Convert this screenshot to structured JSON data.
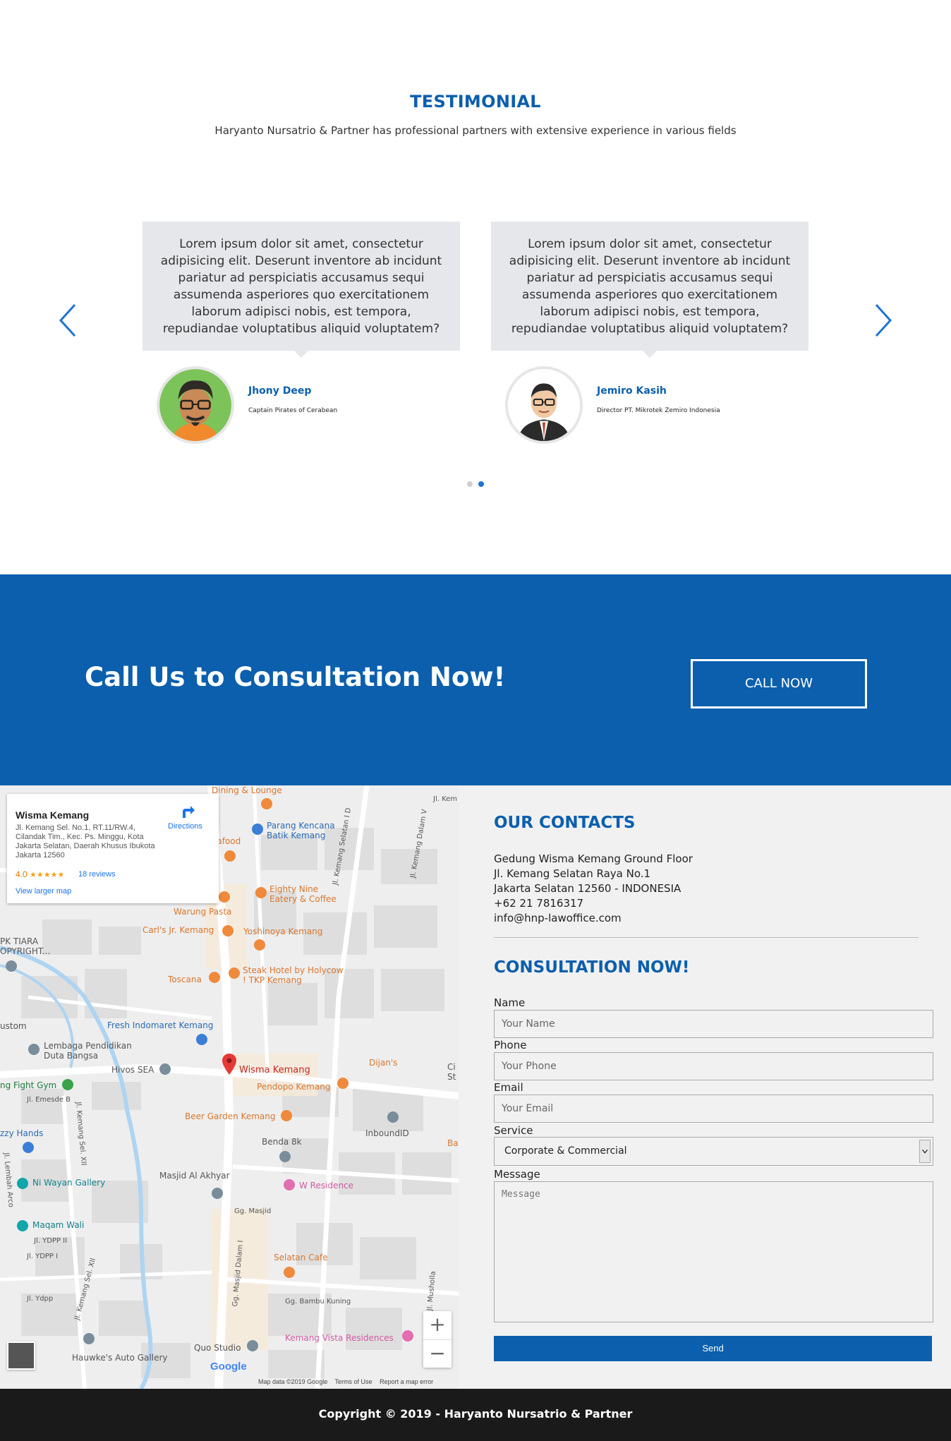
{
  "testimonial": {
    "title": "TESTIMONIAL",
    "subtitle": "Haryanto Nursatrio & Partner has professional partners with extensive experience in various fields",
    "cards": [
      {
        "quote": "Lorem ipsum dolor sit amet, consectetur adipisicing elit. Deserunt inventore ab incidunt pariatur ad perspiciatis accusamus sequi assumenda asperiores quo exercitationem laborum adipisci nobis, est tempora, repudiandae voluptatibus aliquid voluptatem?",
        "name": "Jhony Deep",
        "role": "Captain Pirates of Cerabean"
      },
      {
        "quote": "Lorem ipsum dolor sit amet, consectetur adipisicing elit. Deserunt inventore ab incidunt pariatur ad perspiciatis accusamus sequi assumenda asperiores quo exercitationem laborum adipisci nobis, est tempora, repudiandae voluptatibus aliquid voluptatem?",
        "name": "Jemiro Kasih",
        "role": "Director PT. Mikrotek Zemiro Indonesia"
      }
    ],
    "prev_icon": "chevron-left-icon",
    "next_icon": "chevron-right-icon",
    "pagination": {
      "pages": 2,
      "active": 2
    }
  },
  "cta": {
    "title": "Call Us to Consultation Now!",
    "button": "CALL NOW"
  },
  "map": {
    "place_name": "Wisma Kemang",
    "address": "Jl. Kemang Sel. No.1, RT.11/RW.4, Cilandak Tim., Kec. Ps. Minggu, Kota Jakarta Selatan, Daerah Khusus Ibukota Jakarta 12560",
    "rating": "4.0",
    "stars": "★★★★★",
    "reviews": "18 reviews",
    "directions": "Directions",
    "view_larger": "View larger map",
    "pin_label": "Wisma Kemang",
    "zoom_in": "+",
    "zoom_out": "−",
    "google": "Google",
    "footer": [
      "Map data ©2019 Google",
      "Terms of Use",
      "Report a map error"
    ],
    "labels": {
      "dining": "Dining & Lounge",
      "parang1": "Parang Kencana",
      "parang2": "Batik Kemang",
      "seafood": "eafood",
      "eighty1": "Eighty Nine",
      "eighty2": "Eatery & Coffee",
      "warung": "Warung Pasta",
      "carls": "Carl's Jr. Kemang",
      "yoshi": "Yoshinoya Kemang",
      "tiara1": "PK TIARA",
      "tiara2": "OPYRIGHT...",
      "toscana": "Toscana",
      "steak1": "Steak Hotel by Holycow",
      "steak2": "! TKP Kemang",
      "fresh": "Fresh Indomaret Kemang",
      "ustom": "ustom",
      "lembaga1": "Lembaga Pendidikan",
      "lembaga2": "Duta Bangsa",
      "hivos": "Hivos SEA",
      "dijans": "Dijan's",
      "fight": "ng Fight Gym",
      "pendopo": "Pendopo Kemang",
      "emesde": "Jl. Emesde B",
      "beer": "Beer Garden Kemang",
      "inbound": "InboundID",
      "ba": "Ba",
      "zzy": "zzy Hands",
      "benda": "Benda 8k",
      "masjid": "Masjid Al Akhyar",
      "wres": "W Residence",
      "wayan": "Ni Wayan Gallery",
      "maqam": "Maqam Wali",
      "ydpp2": "Jl. YDPP II",
      "ydpp1": "Jl. YDPP I",
      "ggmasjid": "Gg. Masjid",
      "selatan": "Selatan Cafe",
      "ydpp": "Jl. Ydpp",
      "bambu": "Gg. Bambu Kuning",
      "kvr": "Kemang Vista Residences",
      "quo": "Quo Studio",
      "hauwke": "Hauwke's Auto Gallery",
      "road_kemang_selatan": "Jl. Kemang Selatan I D",
      "road_kemang_dalam": "Jl. Kemang Dalam V",
      "road_jl_kem": "Jl. Kem",
      "road_sel_xii": "Jl. Kemang Sel. XII",
      "road_sel_xii_b": "Jl. Kemang Sel. XII",
      "road_musholla": "Jl. Musholla",
      "road_gg_masjid_dalam": "Gg. Masjid Dalam I",
      "road_lembah": "Jl. Lembah Arco",
      "road_ci": "Ci",
      "road_st": "St"
    }
  },
  "contacts": {
    "heading": "OUR CONTACTS",
    "lines": [
      "Gedung Wisma Kemang Ground Floor",
      "Jl. Kemang Selatan Raya No.1",
      "Jakarta Selatan 12560 - INDONESIA",
      "+62 21 7816317",
      "info@hnp-lawoffice.com"
    ],
    "form_heading": "CONSULTATION NOW!",
    "name_label": "Name",
    "name_placeholder": "Your Name",
    "phone_label": "Phone",
    "phone_placeholder": "Your Phone",
    "email_label": "Email",
    "email_placeholder": "Your Email",
    "service_label": "Service",
    "service_value": "Corporate & Commercial",
    "message_label": "Message",
    "message_placeholder": "Message",
    "send": "Send"
  },
  "footer": {
    "copyright": "Copyright © 2019 - Haryanto Nursatrio & Partner"
  },
  "colors": {
    "brand_blue": "#0b5fad",
    "footer_bg": "#1a1a1a",
    "card_bg": "#e5e7ea",
    "form_bg": "#f1f1f1"
  }
}
